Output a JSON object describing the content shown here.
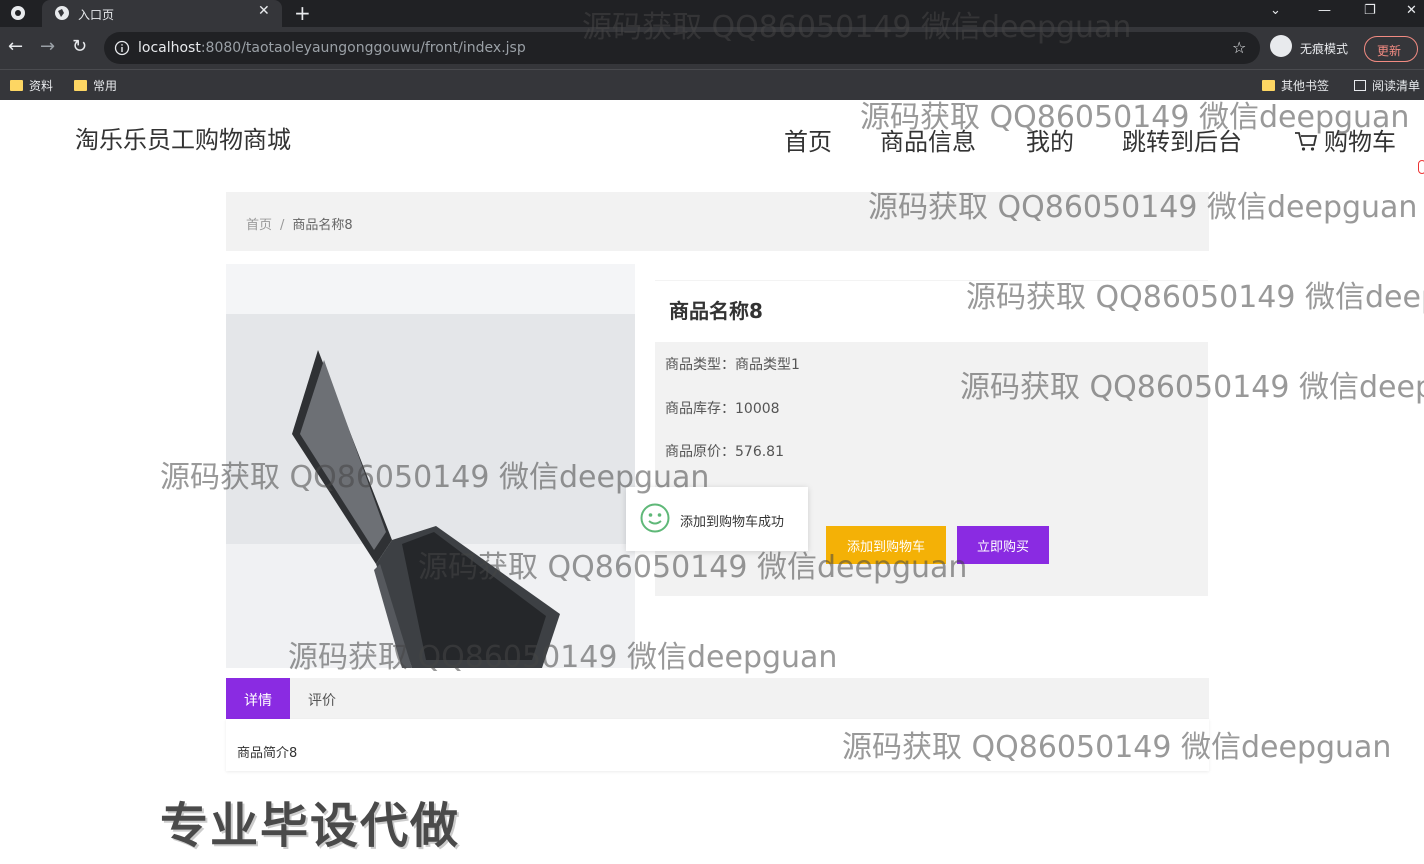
{
  "browser": {
    "tab_title": "入口页",
    "tab_close": "✕",
    "new_tab": "+",
    "url_host": "localhost",
    "url_rest": ":8080/taotaoleyaungonggouwu/front/index.jsp",
    "incognito_label": "无痕模式",
    "update_label": "更新",
    "bookmarks": [
      "资料",
      "常用"
    ],
    "other_bookmarks": "其他书签",
    "reading_list": "阅读清单"
  },
  "site": {
    "title": "淘乐乐员工购物商城",
    "nav": [
      "首页",
      "商品信息",
      "我的",
      "跳转到后台",
      "购物车"
    ]
  },
  "breadcrumb": {
    "home": "首页",
    "separator": "/",
    "current": "商品名称8"
  },
  "product": {
    "name": "商品名称8",
    "type_label": "商品类型：",
    "type_value": "商品类型1",
    "stock_label": "商品库存：",
    "stock_value": "10008",
    "price_label": "商品原价：",
    "price_value": "576.81",
    "add_to_cart": "添加到购物车",
    "buy_now": "立即购买"
  },
  "toast": {
    "message": "添加到购物车成功"
  },
  "detail_tabs": {
    "detail": "详情",
    "review": "评价",
    "content": "商品简介8"
  },
  "overlay": "专业毕设代做",
  "watermark": "源码获取 QQ86050149 微信deepguan",
  "colors": {
    "accent_purple": "#8a2be2",
    "cart_yellow": "#f4b106"
  }
}
